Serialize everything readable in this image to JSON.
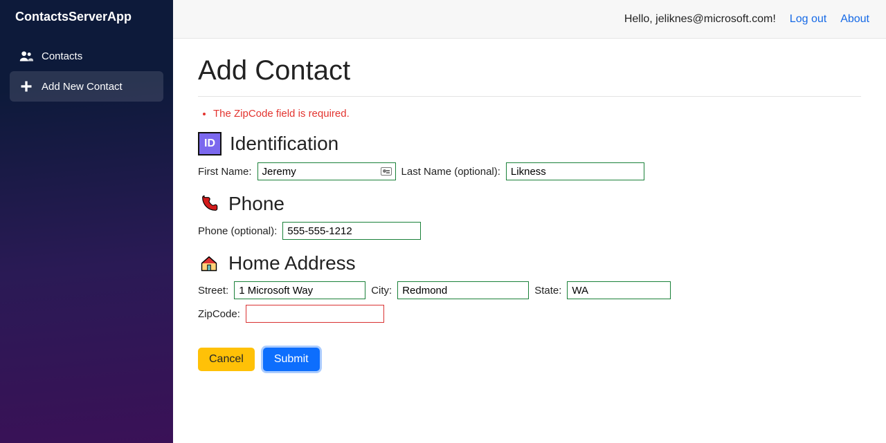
{
  "app": {
    "name": "ContactsServerApp"
  },
  "sidebar": {
    "items": [
      {
        "label": "Contacts"
      },
      {
        "label": "Add New Contact"
      }
    ]
  },
  "topbar": {
    "greeting": "Hello, jeliknes@microsoft.com!",
    "logout": "Log out",
    "about": "About"
  },
  "page": {
    "title": "Add Contact",
    "errors": [
      "The ZipCode field is required."
    ]
  },
  "sections": {
    "identification": {
      "badge": "ID",
      "title": "Identification"
    },
    "phone": {
      "title": "Phone"
    },
    "address": {
      "title": "Home Address"
    }
  },
  "labels": {
    "firstName": "First Name:",
    "lastName": "Last Name (optional):",
    "phone": "Phone (optional):",
    "street": "Street:",
    "city": "City:",
    "state": "State:",
    "zip": "ZipCode:"
  },
  "form": {
    "firstName": "Jeremy",
    "lastName": "Likness",
    "phone": "555-555-1212",
    "street": "1 Microsoft Way",
    "city": "Redmond",
    "state": "WA",
    "zip": ""
  },
  "buttons": {
    "cancel": "Cancel",
    "submit": "Submit"
  }
}
